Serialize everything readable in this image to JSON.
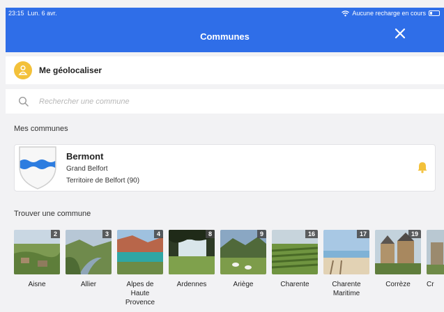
{
  "status_bar": {
    "time": "23:15",
    "date": "Lun. 6 avr.",
    "battery_text": "Aucune recharge en cours"
  },
  "header": {
    "title": "Communes"
  },
  "geolocate": {
    "label": "Me géolocaliser"
  },
  "search": {
    "placeholder": "Rechercher une commune"
  },
  "my_communes": {
    "title": "Mes communes",
    "items": [
      {
        "name": "Bermont",
        "line1": "Grand Belfort",
        "line2": "Territoire de Belfort (90)"
      }
    ]
  },
  "find": {
    "title": "Trouver une commune",
    "departments": [
      {
        "name": "Aisne",
        "count": "2"
      },
      {
        "name": "Allier",
        "count": "3"
      },
      {
        "name": "Alpes de Haute Provence",
        "count": "4"
      },
      {
        "name": "Ardennes",
        "count": "8"
      },
      {
        "name": "Ariège",
        "count": "9"
      },
      {
        "name": "Charente",
        "count": "16"
      },
      {
        "name": "Charente Maritime",
        "count": "17"
      },
      {
        "name": "Corrèze",
        "count": "19"
      },
      {
        "name": "Cr",
        "count": ""
      }
    ]
  },
  "colors": {
    "accent": "#2f6ee8",
    "geo_icon": "#f3c13a",
    "bell": "#f3c13a",
    "crest_wave": "#2d7de0"
  }
}
